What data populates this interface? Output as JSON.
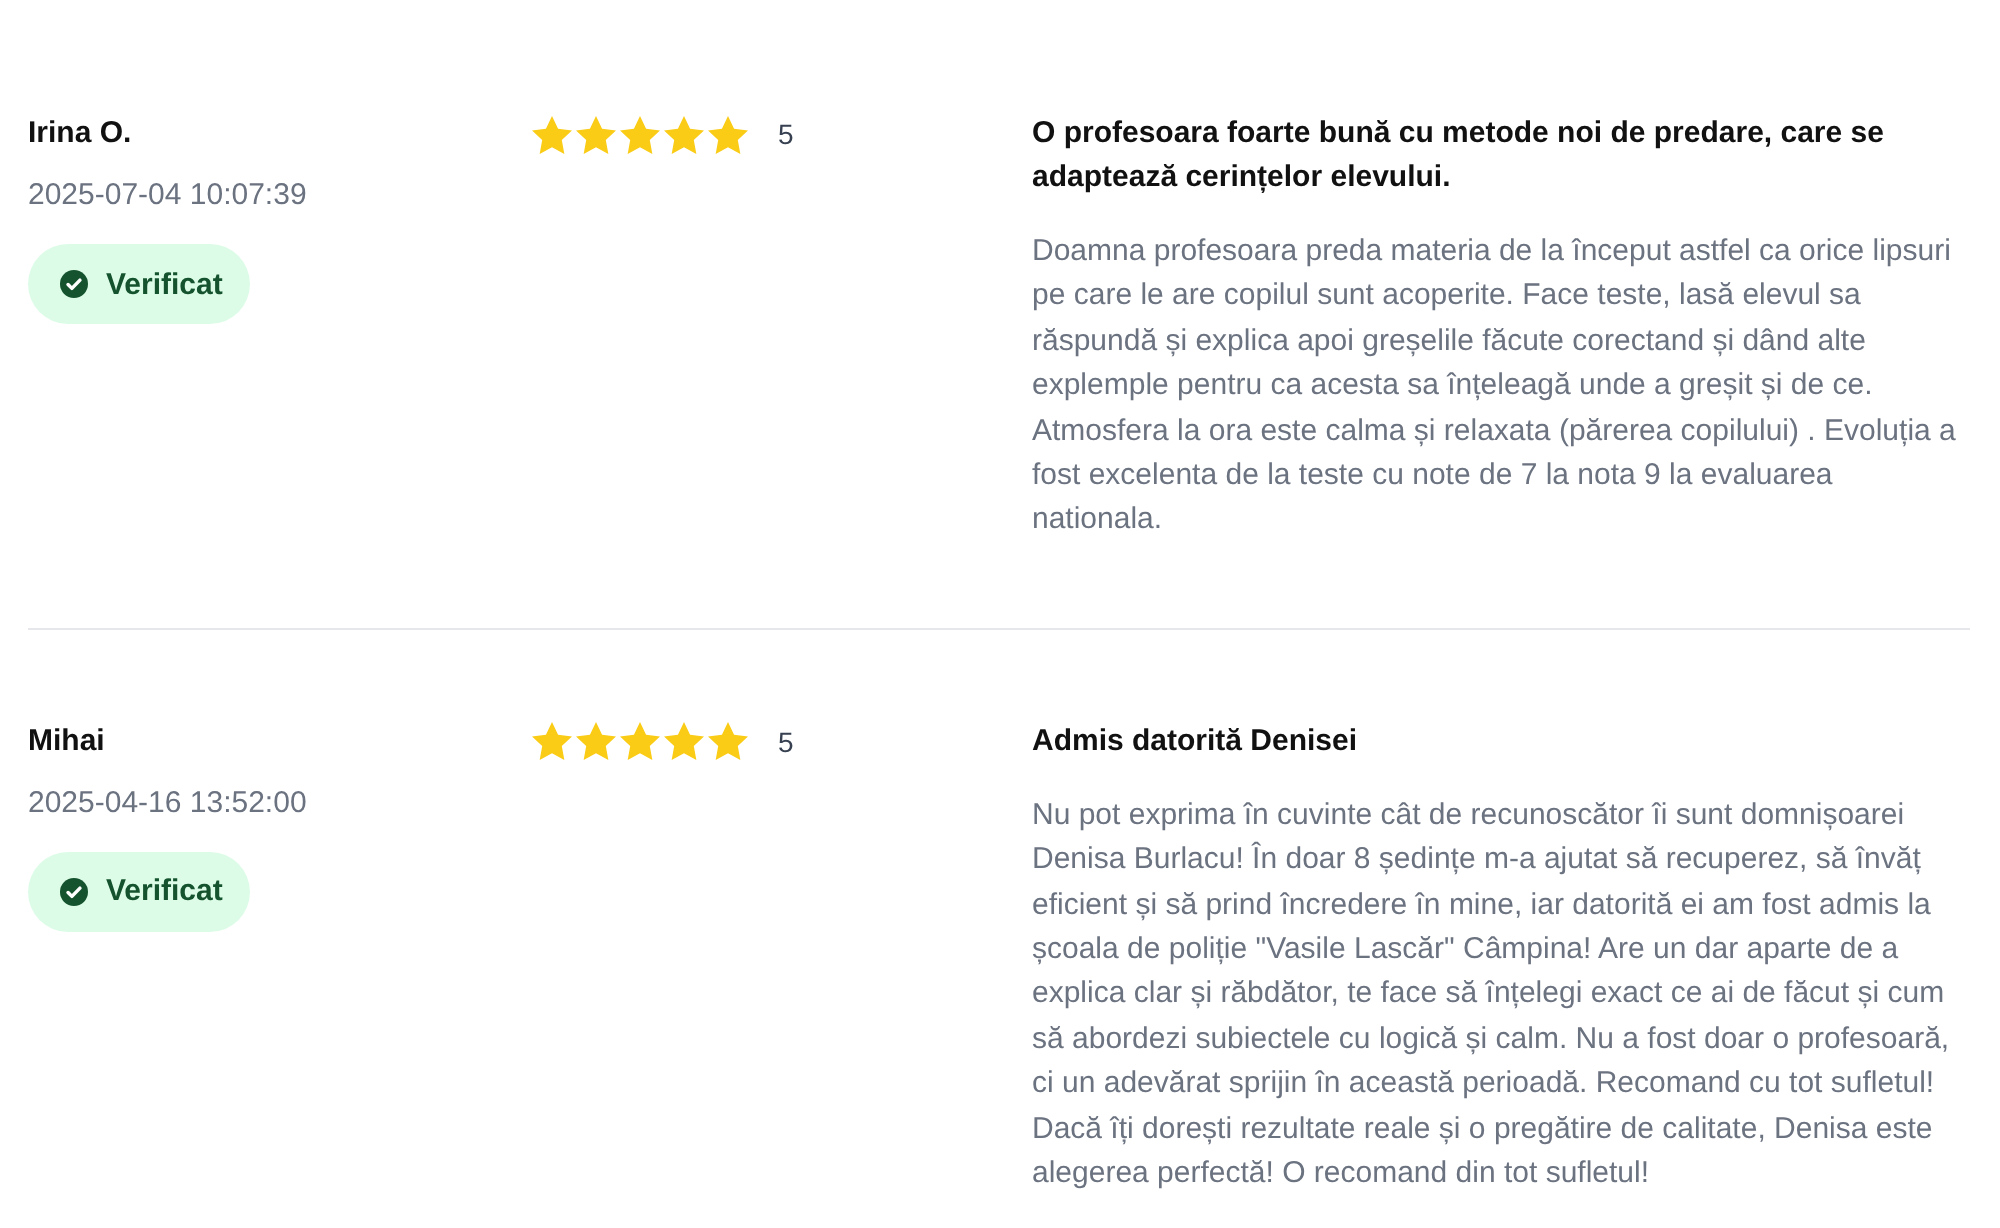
{
  "reviews": [
    {
      "author": "Irina O.",
      "date": "2025-07-04 10:07:39",
      "badge": "Verificat",
      "stars": 5,
      "rating": "5",
      "title": "O profesoara foarte bună cu metode noi de predare, care se adaptează cerințelor elevului.",
      "body": "Doamna profesoara preda materia de la început astfel ca orice lipsuri pe care le are copilul sunt acoperite. Face teste, lasă elevul sa răspundă și explica apoi greșelile făcute corectand și dând alte explemple pentru ca acesta sa înțeleagă unde a greșit și de ce. Atmosfera la ora este calma și relaxata (părerea copilului) . Evoluția a fost excelenta de la teste cu note de 7 la nota 9 la evaluarea nationala."
    },
    {
      "author": "Mihai",
      "date": "2025-04-16 13:52:00",
      "badge": "Verificat",
      "stars": 5,
      "rating": "5",
      "title": "Admis datorită Denisei",
      "body": "Nu pot exprima în cuvinte cât de recunoscător îi sunt domnișoarei Denisa Burlacu! În doar 8 ședințe m-a ajutat să recuperez, să învăț eficient și să prind încredere în mine, iar datorită ei am fost admis la școala de poliție \"Vasile Lascăr\" Câmpina! Are un dar aparte de a explica clar și răbdător, te face să înțelegi exact ce ai de făcut și cum să abordezi subiectele cu logică și calm. Nu a fost doar o profesoară, ci un adevărat sprijin în această perioadă. Recomand cu tot sufletul! Dacă îți dorești rezultate reale și o pregătire de calitate, Denisa este alegerea perfectă! O recomand din tot sufletul!"
    }
  ]
}
